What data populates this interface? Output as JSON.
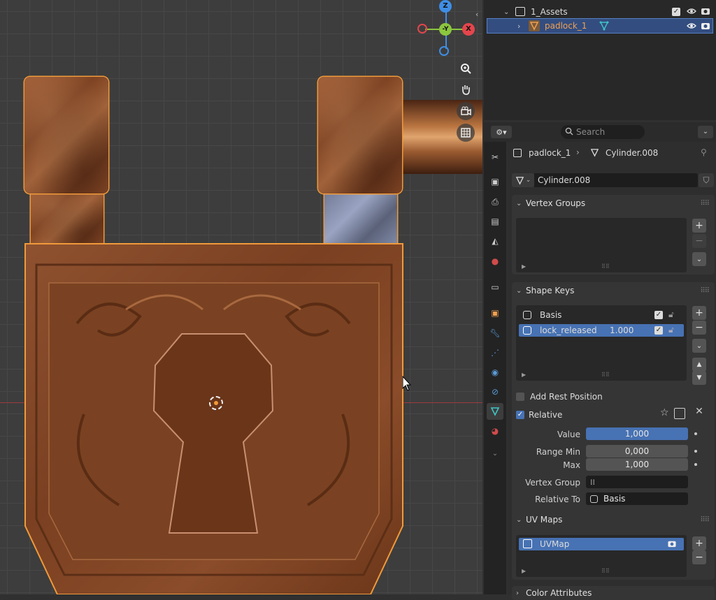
{
  "outliner": {
    "rows": [
      {
        "label": "1_Assets",
        "type": "collection"
      },
      {
        "label": "padlock_1",
        "type": "object",
        "selected": true
      }
    ]
  },
  "props_header": {
    "search_placeholder": "Search"
  },
  "breadcrumb": {
    "object": "padlock_1",
    "data": "Cylinder.008"
  },
  "mesh_datablock": {
    "name": "Cylinder.008"
  },
  "panels": {
    "vertex_groups": {
      "title": "Vertex Groups"
    },
    "shape_keys": {
      "title": "Shape Keys",
      "keys": [
        {
          "name": "Basis",
          "value": "",
          "enabled": true
        },
        {
          "name": "lock_released",
          "value": "1.000",
          "enabled": true,
          "selected": true
        }
      ],
      "add_rest_position": "Add Rest Position",
      "relative": "Relative",
      "value_label": "Value",
      "value": "1,000",
      "range_min_label": "Range Min",
      "range_min": "0,000",
      "max_label": "Max",
      "max": "1,000",
      "vertex_group_label": "Vertex Group",
      "relative_to_label": "Relative To",
      "relative_to": "Basis"
    },
    "uv_maps": {
      "title": "UV Maps",
      "maps": [
        {
          "name": "UVMap"
        }
      ]
    },
    "color_attributes": {
      "title": "Color Attributes"
    }
  },
  "gizmo": {
    "z": "Z",
    "y": "-Y",
    "x": "X"
  },
  "colors": {
    "selection_blue": "#4772b3",
    "outline_orange": "#f09a3a",
    "axis_x": "#e5454c",
    "axis_y": "#8bc63f",
    "axis_z": "#3f8ee5"
  }
}
